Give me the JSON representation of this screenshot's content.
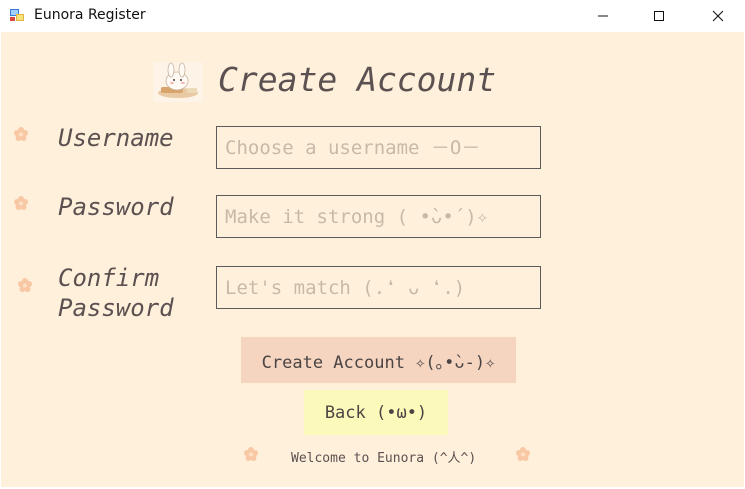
{
  "window": {
    "title": "Eunora Register",
    "icon": "app-window-icon",
    "controls": {
      "minimize": "minimize-icon",
      "maximize": "maximize-icon",
      "close": "close-icon"
    }
  },
  "form": {
    "heading": "Create Account",
    "heading_icon": "bunny-baking-icon",
    "username": {
      "label": "Username",
      "placeholder": "Choose a username －O－"
    },
    "password": {
      "label": "Password",
      "placeholder": "Make it strong ( •̀ᴗ•́ )✧"
    },
    "confirm": {
      "label_line1": "Confirm",
      "label_line2": "Password",
      "placeholder": "Let's match (.❛ ᴗ ❛.)"
    },
    "create_button": "Create Account ✧(｡•̀ᴗ-)✧",
    "back_button": "Back (•ω•)",
    "footer": "Welcome to Eunora (^人^)"
  },
  "colors": {
    "background": "#fff0db",
    "text": "#5b5151",
    "placeholder": "#c9b8a8",
    "create_button_bg": "#f5d5c0",
    "back_button_bg": "#fcfabb",
    "flower": "#f8c7a4"
  }
}
